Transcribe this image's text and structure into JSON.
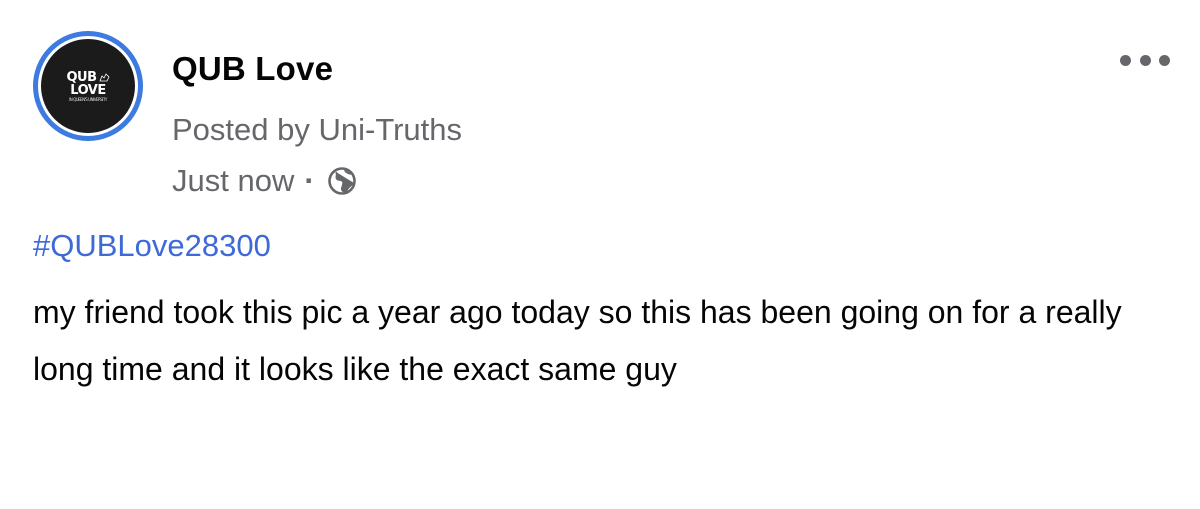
{
  "post": {
    "avatar": {
      "logo_line1": "QUB",
      "logo_line2": "LOVE",
      "logo_small": "IN QUEEN'S UNIVERSITY"
    },
    "page_name": "QUB Love",
    "posted_by": "Posted by Uni-Truths",
    "timestamp": "Just now",
    "separator": "·",
    "audience_icon": "globe-icon",
    "more_icon": "more-options-icon",
    "hashtag": "#QUBLove28300",
    "body": "my friend took this pic a year ago today so this has been going on for a really long time and it looks like the exact same guy"
  },
  "colors": {
    "accent": "#3d6ad6",
    "ring": "#3d7be0",
    "secondary_text": "#65676b",
    "primary_text": "#050505"
  }
}
